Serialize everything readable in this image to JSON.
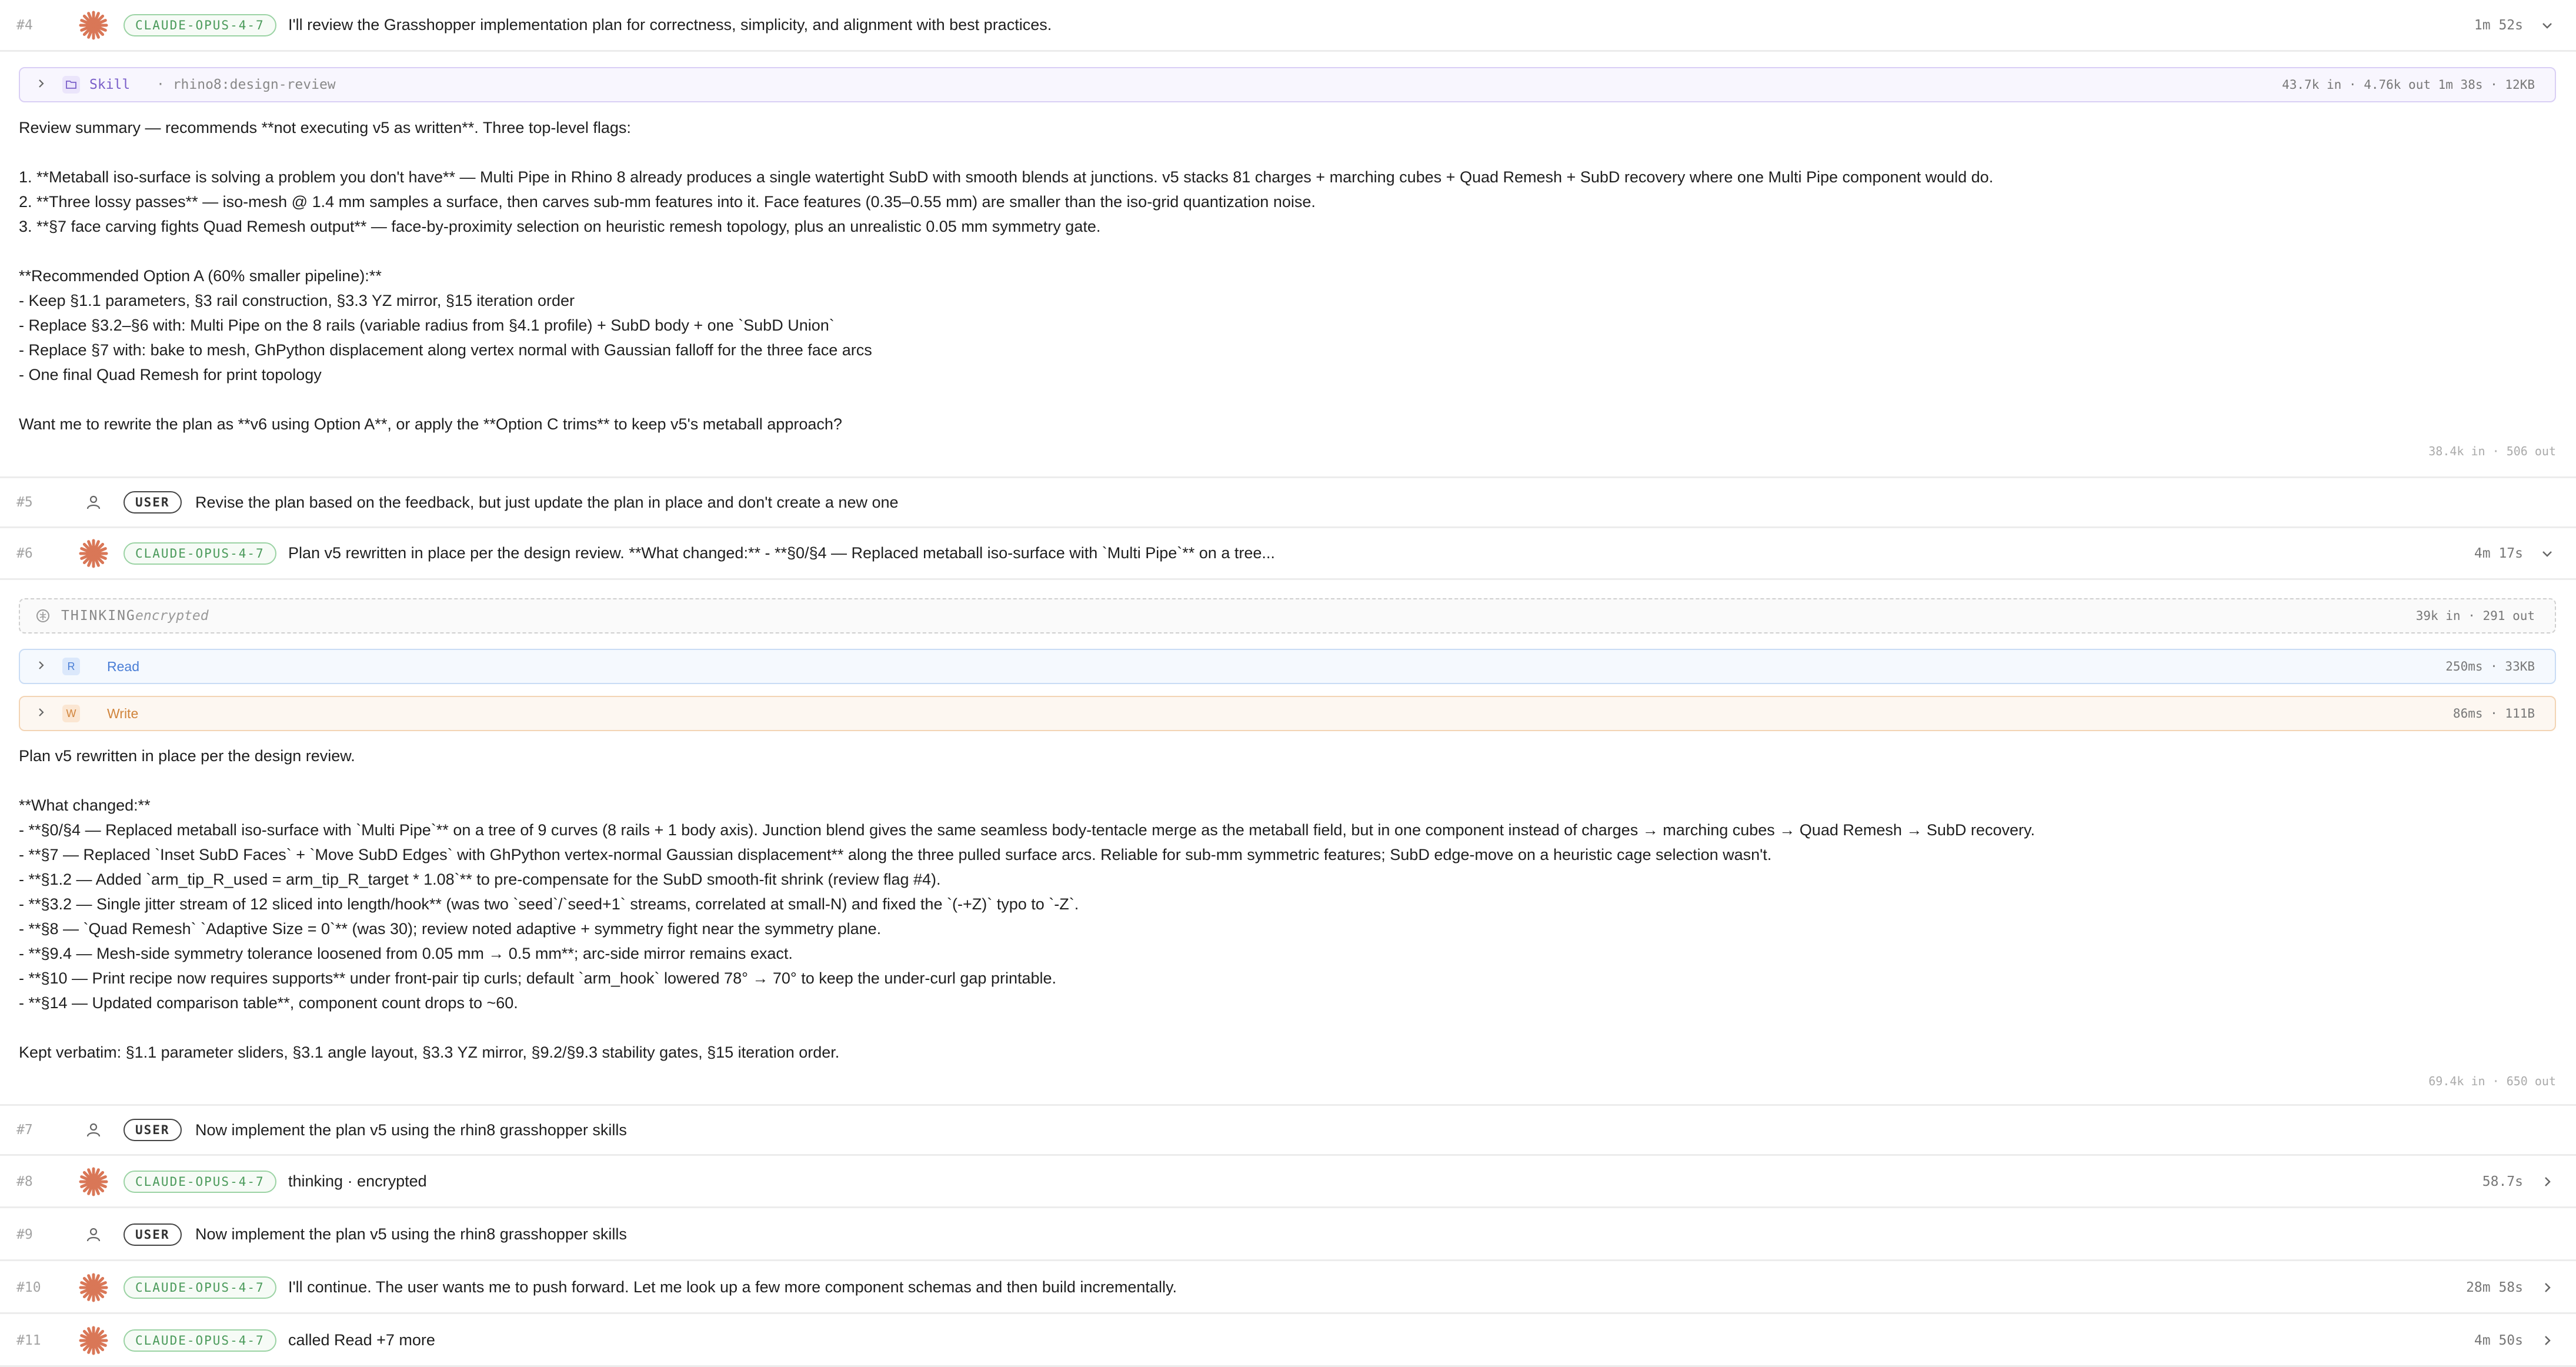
{
  "colors": {
    "claude_accent": "#4a9a5a",
    "claude_star": "#d97757",
    "skill": "#7a5fc9",
    "read": "#4a7ed6",
    "write": "#d0843c"
  },
  "rows": [
    {
      "num": "#4",
      "role": "CLAUDE-OPUS-4-7",
      "text": "I'll review the Grasshopper implementation plan for correctness, simplicity, and alignment with best practices.",
      "meta": "1m 52s"
    },
    {
      "num": "#5",
      "role": "USER",
      "text": "Revise the plan based on the feedback, but just update the plan in place and don't create a new one"
    },
    {
      "num": "#6",
      "role": "CLAUDE-OPUS-4-7",
      "text": "Plan v5 rewritten in place per the design review. **What changed:** - **§0/§4 — Replaced metaball iso-surface with `Multi Pipe`** on a tree...",
      "meta": "4m 17s"
    },
    {
      "num": "#7",
      "role": "USER",
      "text": "Now implement the plan v5 using the rhin8 grasshopper skills"
    },
    {
      "num": "#8",
      "role": "CLAUDE-OPUS-4-7",
      "text": "thinking · encrypted",
      "meta": "58.7s"
    },
    {
      "num": "#9",
      "role": "USER",
      "text": "Now implement the plan v5 using the rhin8 grasshopper skills"
    },
    {
      "num": "#10",
      "role": "CLAUDE-OPUS-4-7",
      "text": "I'll continue. The user wants me to push forward. Let me look up a few more component schemas and then build incrementally.",
      "meta": "28m 58s"
    },
    {
      "num": "#11",
      "role": "CLAUDE-OPUS-4-7",
      "text": "called Read +7 more",
      "meta": "4m 50s"
    }
  ],
  "skill_card": {
    "label": "Skill",
    "sub": "· rhino8:design-review",
    "meta": "43.7k in · 4.76k out  1m 38s · 12KB"
  },
  "review": {
    "lines": [
      "Review summary — recommends **not executing v5 as written**. Three top-level flags:",
      "",
      "1. **Metaball iso-surface is solving a problem you don't have** — Multi Pipe in Rhino 8 already produces a single watertight SubD with smooth blends at junctions. v5 stacks 81 charges + marching cubes + Quad Remesh + SubD recovery where one Multi Pipe component would do.",
      "2. **Three lossy passes** — iso-mesh @ 1.4 mm samples a surface, then carves sub-mm features into it. Face features (0.35–0.55 mm) are smaller than the iso-grid quantization noise.",
      "3. **§7 face carving fights Quad Remesh output** — face-by-proximity selection on heuristic remesh topology, plus an unrealistic 0.05 mm symmetry gate.",
      "",
      "**Recommended Option A (60% smaller pipeline):**",
      "- Keep §1.1 parameters, §3 rail construction, §3.3 YZ mirror, §15 iteration order",
      "- Replace §3.2–§6 with: Multi Pipe on the 8 rails (variable radius from §4.1 profile) + SubD body + one `SubD Union`",
      "- Replace §7 with: bake to mesh, GhPython displacement along vertex normal with Gaussian falloff for the three face arcs",
      "- One final Quad Remesh for print topology",
      "",
      "Want me to rewrite the plan as **v6 using Option A**, or apply the **Option C trims** to keep v5's metaball approach?"
    ],
    "tokens": "38.4k in · 506 out"
  },
  "thinking_card": {
    "label": "THINKING",
    "sub": "encrypted",
    "meta": "39k in · 291 out"
  },
  "read_card": {
    "label": "Read",
    "icon": "R",
    "meta": "250ms · 33KB"
  },
  "write_card": {
    "label": "Write",
    "icon": "W",
    "meta": "86ms · 111B"
  },
  "changes": {
    "lines": [
      "Plan v5 rewritten in place per the design review.",
      "",
      "**What changed:**",
      "- **§0/§4 — Replaced metaball iso-surface with `Multi Pipe`** on a tree of 9 curves (8 rails + 1 body axis). Junction blend gives the same seamless body-tentacle merge as the metaball field, but in one component instead of charges → marching cubes → Quad Remesh → SubD recovery.",
      "- **§7 — Replaced `Inset SubD Faces` + `Move SubD Edges` with GhPython vertex-normal Gaussian displacement** along the three pulled surface arcs. Reliable for sub-mm symmetric features; SubD edge-move on a heuristic cage selection wasn't.",
      "- **§1.2 — Added `arm_tip_R_used = arm_tip_R_target * 1.08`** to pre-compensate for the SubD smooth-fit shrink (review flag #4).",
      "- **§3.2 — Single jitter stream of 12 sliced into length/hook** (was two `seed`/`seed+1` streams, correlated at small-N) and fixed the `(-+Z)` typo to `-Z`.",
      "- **§8 — `Quad Remesh` `Adaptive Size = 0`** (was 30); review noted adaptive + symmetry fight near the symmetry plane.",
      "- **§9.4 — Mesh-side symmetry tolerance loosened from 0.05 mm → 0.5 mm**; arc-side mirror remains exact.",
      "- **§10 — Print recipe now requires supports** under front-pair tip curls; default `arm_hook` lowered 78° → 70° to keep the under-curl gap printable.",
      "- **§14 — Updated comparison table**, component count drops to ~60.",
      "",
      "Kept verbatim: §1.1 parameter sliders, §3.1 angle layout, §3.3 YZ mirror, §9.2/§9.3 stability gates, §15 iteration order."
    ],
    "tokens": "69.4k in · 650 out"
  }
}
